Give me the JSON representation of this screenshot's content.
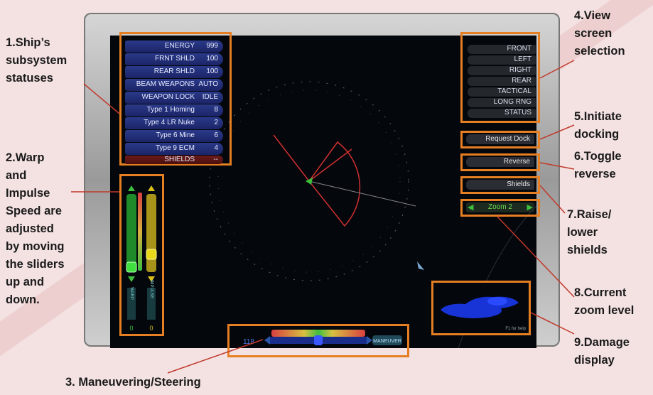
{
  "callouts": {
    "c1": [
      "1.Ship’s",
      "subsystem",
      "statuses"
    ],
    "c2": [
      "2.Warp",
      "and",
      "Impulse",
      "Speed are",
      "adjusted",
      "by moving",
      "the sliders",
      "up and",
      "down."
    ],
    "c3": "3. Maneuvering/Steering",
    "c4": [
      "4.View",
      "screen",
      "selection"
    ],
    "c5": [
      "5.Initiate",
      "docking"
    ],
    "c6": [
      "6.Toggle",
      "reverse"
    ],
    "c7": [
      "7.Raise/",
      "lower",
      "shields"
    ],
    "c8": [
      "8.Current",
      "zoom level"
    ],
    "c9": [
      "9.Damage",
      "display"
    ]
  },
  "subsystems": [
    {
      "label": "ENERGY",
      "value": "999"
    },
    {
      "label": "FRNT SHLD",
      "value": "100"
    },
    {
      "label": "REAR SHLD",
      "value": "100"
    },
    {
      "label": "BEAM WEAPONS",
      "value": "AUTO"
    },
    {
      "label": "WEAPON LOCK",
      "value": "IDLE"
    },
    {
      "label": "Type 1 Homing",
      "value": "8"
    },
    {
      "label": "Type 4 LR Nuke",
      "value": "2"
    },
    {
      "label": "Type 6 Mine",
      "value": "6"
    },
    {
      "label": "Type 9 ECM",
      "value": "4"
    },
    {
      "label": "SHIELDS",
      "value": "--"
    }
  ],
  "view_buttons": [
    "FRONT",
    "LEFT",
    "RIGHT",
    "REAR",
    "TACTICAL",
    "LONG RNG",
    "STATUS"
  ],
  "buttons": {
    "dock": "Request Dock",
    "reverse": "Reverse",
    "shields": "Shields",
    "zoom": "Zoom 2"
  },
  "speed": {
    "warp_label": "WARP",
    "impulse_label": "IMPULSE",
    "warp_value": "0",
    "impulse_value": "0"
  },
  "maneuver": {
    "heading": "118",
    "label": "MANEUVER"
  },
  "help_text": "F1 for help",
  "colors": {
    "callout_border": "#e67e22",
    "callout_line": "#c0392b",
    "panel_blue": "#2a3a8a",
    "slider_green": "#3fbf3f",
    "slider_yellow": "#d8c21a"
  }
}
